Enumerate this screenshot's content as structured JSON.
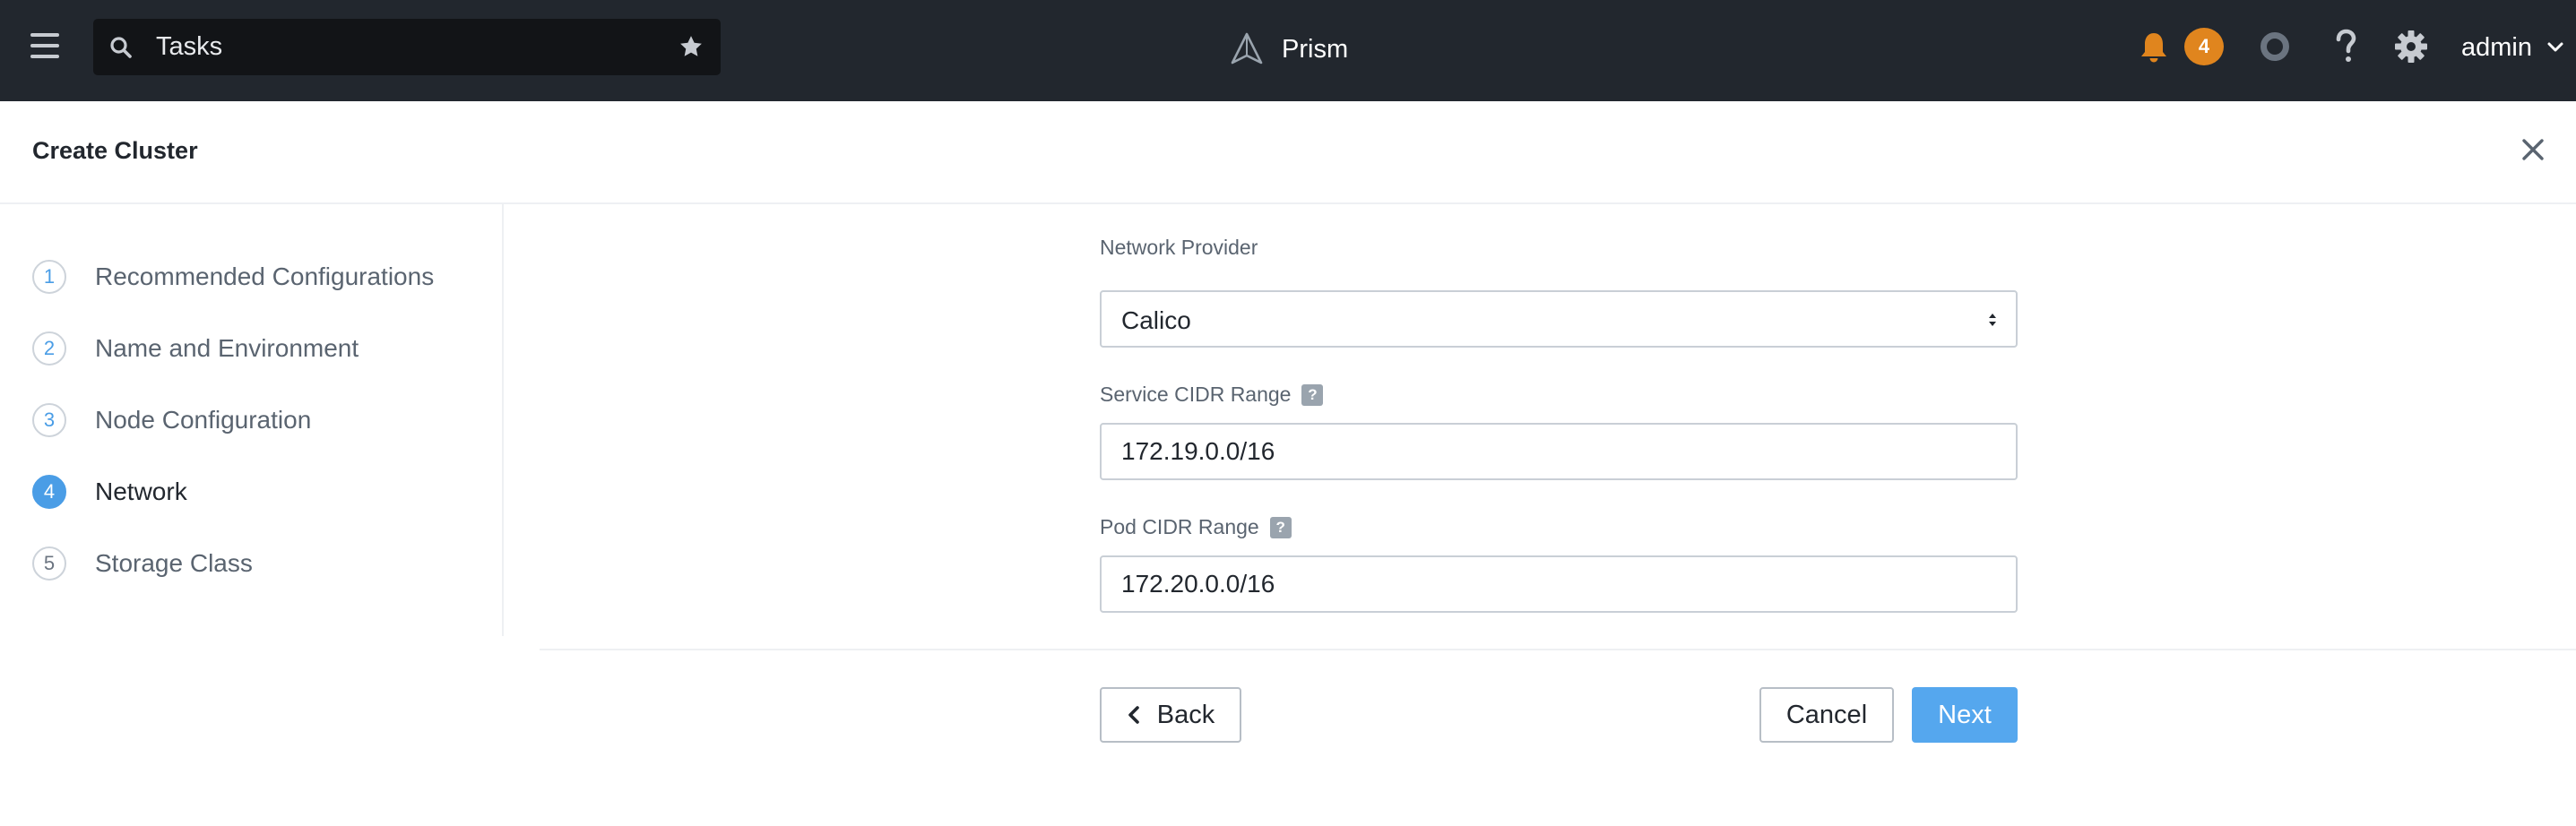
{
  "topbar": {
    "search_text": "Tasks",
    "brand": "Prism",
    "notification_count": "4",
    "user": "admin"
  },
  "dialog": {
    "title": "Create Cluster"
  },
  "steps": [
    {
      "num": "1",
      "label": "Recommended Configurations",
      "state": "done"
    },
    {
      "num": "2",
      "label": "Name and Environment",
      "state": "done"
    },
    {
      "num": "3",
      "label": "Node Configuration",
      "state": "done"
    },
    {
      "num": "4",
      "label": "Network",
      "state": "active"
    },
    {
      "num": "5",
      "label": "Storage Class",
      "state": "upcoming"
    }
  ],
  "form": {
    "network_provider_label": "Network Provider",
    "network_provider_value": "Calico",
    "service_cidr_label": "Service CIDR Range",
    "service_cidr_value": "172.19.0.0/16",
    "pod_cidr_label": "Pod CIDR Range",
    "pod_cidr_value": "172.20.0.0/16",
    "help_glyph": "?"
  },
  "buttons": {
    "back": "Back",
    "cancel": "Cancel",
    "next": "Next"
  },
  "colors": {
    "topbar_bg": "#22272e",
    "accent": "#4a9de6",
    "badge": "#e0851e",
    "next_button": "#55a7ee"
  }
}
